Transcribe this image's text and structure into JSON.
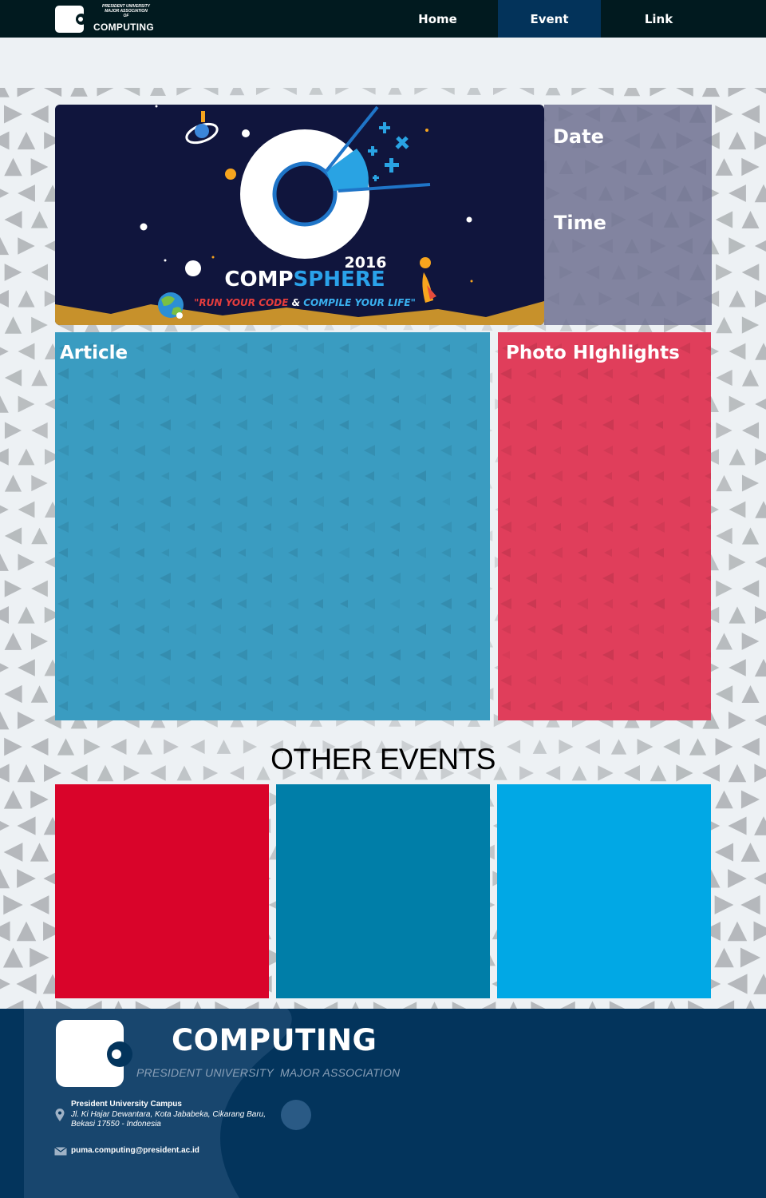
{
  "nav": {
    "logo": {
      "subtitle_lines": [
        "PRESIDENT UNIVERSITY",
        "MAJOR ASSOCIATION",
        "OF"
      ],
      "name": "COMPUTING"
    },
    "items": [
      {
        "label": "Home",
        "active": false
      },
      {
        "label": "Event",
        "active": true
      },
      {
        "label": "Link",
        "active": false
      }
    ],
    "colors": {
      "bar": "#011a1f",
      "active": "#03335a"
    }
  },
  "hero": {
    "year": "2016",
    "title_part1": "COMP",
    "title_part2": "SPHERE",
    "tagline_part1": "\"RUN YOUR CODE",
    "tagline_amp": "&",
    "tagline_part2": "COMPILE YOUR LIFE\""
  },
  "info": {
    "date_label": "Date",
    "time_label": "Time"
  },
  "article": {
    "title": "Article",
    "color": "#3a9cc1"
  },
  "photo": {
    "title": "Photo HIghlights",
    "color": "#e03e5b"
  },
  "other_events": {
    "title": "OTHER EVENTS",
    "tiles": [
      {
        "color": "#d9042a"
      },
      {
        "color": "#007ea8"
      },
      {
        "color": "#01a8e5"
      }
    ]
  },
  "footer": {
    "title": "COMPUTING",
    "subtitle": "PRESIDENT UNIVERSITY  MAJOR ASSOCIATION",
    "address_title": "President University Campus",
    "address_line1": "Jl. Ki Hajar Dewantara, Kota Jababeka, Cikarang Baru,",
    "address_line2": "Bekasi 17550 - Indonesia",
    "email": "puma.computing@president.ac.id",
    "icons": [
      "location-pin-icon",
      "envelope-icon"
    ]
  }
}
